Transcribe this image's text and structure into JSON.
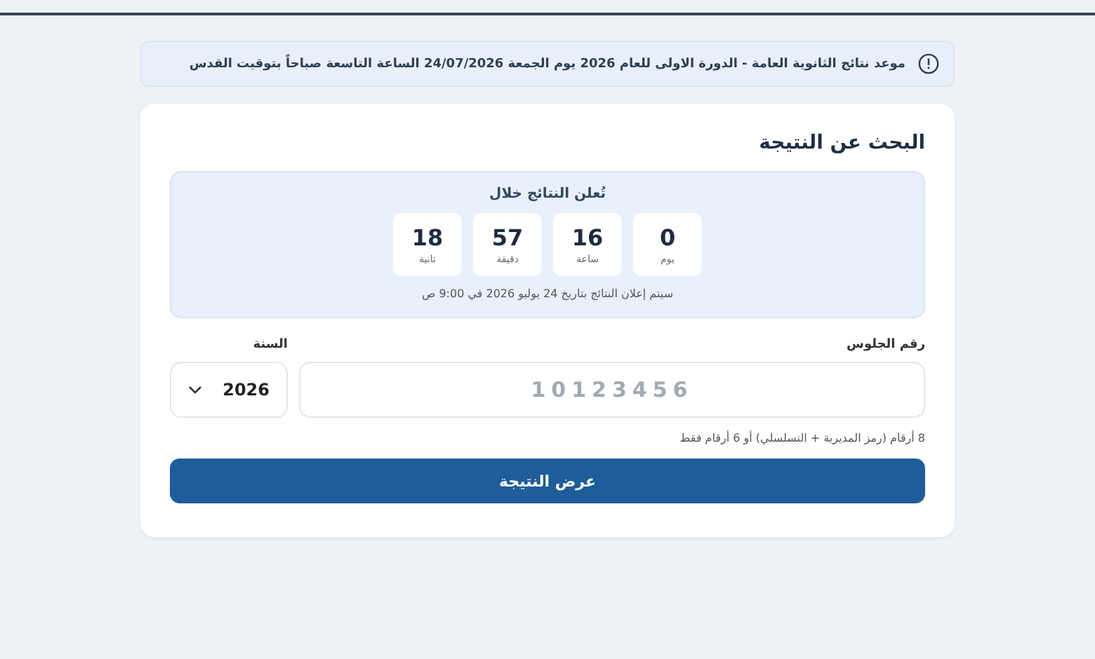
{
  "notice": {
    "text": "موعد نتائج الثانوية العامة - الدورة الاولى للعام 2026 يوم الجمعة 24/07/2026 الساعة التاسعة صباحاً بتوقيت القدس"
  },
  "search": {
    "title": "البحث عن النتيجة",
    "countdown": {
      "title": "تُعلن النتائج خلال",
      "units": [
        {
          "value": "0",
          "label": "يوم"
        },
        {
          "value": "16",
          "label": "ساعة"
        },
        {
          "value": "57",
          "label": "دقيقة"
        },
        {
          "value": "18",
          "label": "ثانية"
        }
      ],
      "note": "سيتم إعلان النتائج بتاريخ 24 يوليو 2026 في 9:00 ص"
    },
    "seat_field": {
      "label": "رقم الجلوس",
      "placeholder": "10123456"
    },
    "year_field": {
      "label": "السنة",
      "value": "2026"
    },
    "hint": "8 أرقام (رمز المديرية + التسلسلي) أو 6 أرقام فقط",
    "submit": "عرض النتيجة"
  }
}
